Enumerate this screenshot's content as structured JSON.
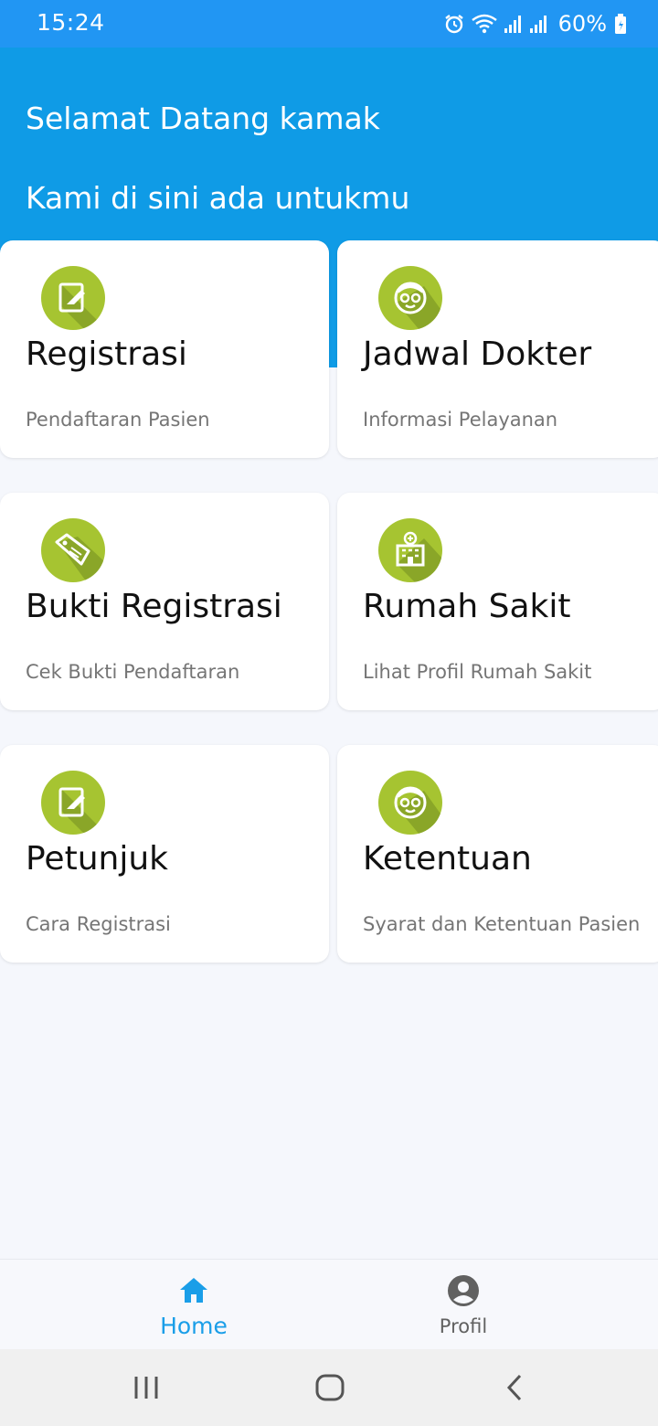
{
  "status_bar": {
    "time": "15:24",
    "battery_percent": "60%",
    "icons": [
      "alarm-icon",
      "wifi-icon",
      "signal-icon",
      "signal-icon",
      "battery-icon"
    ]
  },
  "header": {
    "welcome": "Selamat Datang kamak",
    "tagline": "Kami di sini ada untukmu"
  },
  "menu": [
    {
      "title": "Registrasi",
      "subtitle": "Pendaftaran Pasien",
      "icon": "edit-document-icon"
    },
    {
      "title": "Jadwal Dokter",
      "subtitle": "Informasi Pelayanan",
      "icon": "doctor-face-icon"
    },
    {
      "title": "Bukti Registrasi",
      "subtitle": "Cek Bukti Pendaftaran",
      "icon": "receipt-tag-icon"
    },
    {
      "title": "Rumah Sakit",
      "subtitle": "Lihat Profil Rumah Sakit",
      "icon": "hospital-building-icon"
    },
    {
      "title": "Petunjuk",
      "subtitle": "Cara Registrasi",
      "icon": "edit-document-icon"
    },
    {
      "title": "Ketentuan",
      "subtitle": "Syarat dan Ketentuan Pasien",
      "icon": "doctor-face-icon"
    }
  ],
  "bottom_nav": {
    "items": [
      {
        "label": "Home",
        "icon": "home-icon",
        "active": true
      },
      {
        "label": "Profil",
        "icon": "account-circle-icon",
        "active": false
      }
    ]
  },
  "colors": {
    "status_bar": "#2196f3",
    "header": "#0f9be6",
    "icon_green": "#a6c431",
    "active_nav": "#1a9ee8",
    "background": "#f5f7fc"
  }
}
